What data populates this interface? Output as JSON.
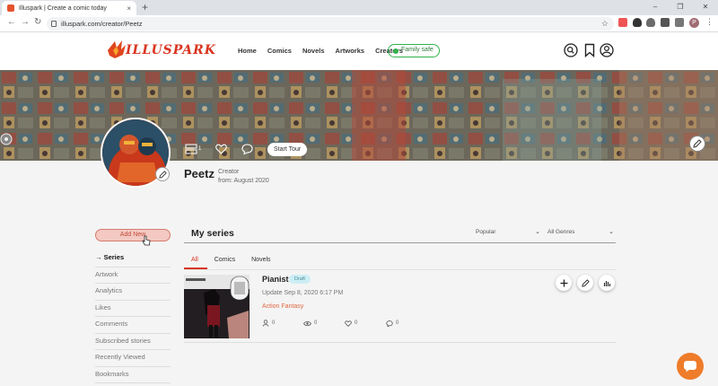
{
  "browser": {
    "tab_title": "Illuspark | Create a comic today",
    "tab_close": "×",
    "new_tab": "+",
    "url": "illuspark.com/creator/Peetz",
    "profile_initial": "P",
    "window_minimize": "–",
    "window_restore": "❐",
    "window_close": "✕"
  },
  "header": {
    "logo_text": "ILLUSPARK",
    "nav": [
      "Home",
      "Comics",
      "Novels",
      "Artworks",
      "Creators"
    ],
    "family_safe": "Family safe"
  },
  "profile": {
    "series_count": "1",
    "start_tour": "Start Tour",
    "name": "Peetz",
    "role": "Creator",
    "from": "from: August 2020"
  },
  "sidebar": {
    "add_new": "Add New",
    "items": [
      "Series",
      "Artwork",
      "Analytics",
      "Likes",
      "Comments",
      "Subscribed stories",
      "Recently Viewed",
      "Bookmarks"
    ],
    "active_arrow": "→"
  },
  "main": {
    "heading": "My series",
    "sort": "Popular",
    "genre": "All Genres",
    "tabs": [
      "All",
      "Comics",
      "Novels"
    ]
  },
  "series": [
    {
      "title": "Pianist",
      "badge": "Draft",
      "updated": "Update Sep 8, 2020 6:17 PM",
      "genres": "Action Fantasy",
      "subscribers": "0",
      "views": "0",
      "likes": "0",
      "comments": "0"
    }
  ],
  "colors": {
    "accent": "#d9341f",
    "family_safe": "#2fb34a",
    "chat": "#ee7c2a",
    "badge_bg": "#cdeef5"
  }
}
